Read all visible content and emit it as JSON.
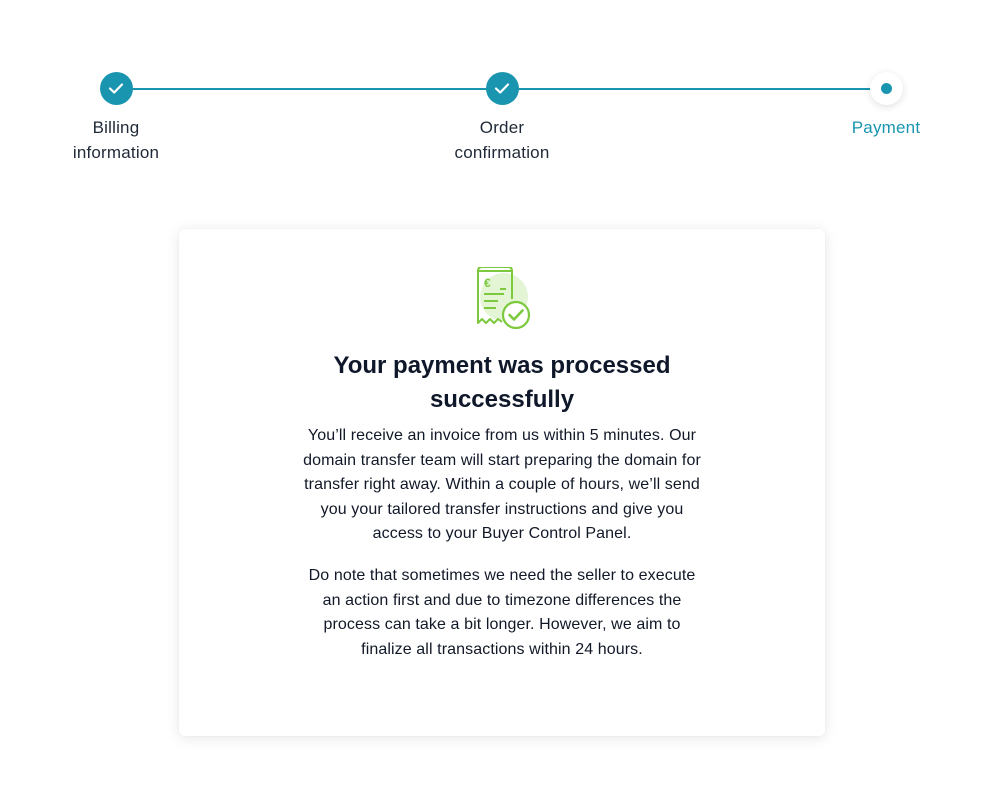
{
  "stepper": {
    "steps": [
      {
        "line1": "Billing",
        "line2": "information",
        "state": "done"
      },
      {
        "line1": "Order",
        "line2": "confirmation",
        "state": "done"
      },
      {
        "line1": "Payment",
        "line2": "",
        "state": "current"
      }
    ],
    "accent_color": "#1a95b0"
  },
  "card": {
    "icon": "receipt-euro-check-icon",
    "icon_currency": "€",
    "title_line1": "Your payment was processed",
    "title_line2": "successfully",
    "paragraph1_lines": [
      "You’ll receive an invoice from us within 5 minutes. Our",
      "domain transfer team will start preparing the domain for",
      "transfer right away. Within a couple of hours, we’ll send",
      "you your tailored transfer instructions and give you",
      "access to your Buyer Control Panel."
    ],
    "paragraph2_lines": [
      "Do note that sometimes we need the seller to execute",
      "an action first and due to timezone differences the",
      "process can take a bit longer. However, we aim to",
      "finalize all transactions within 24 hours."
    ],
    "icon_color": "#7cc93e"
  }
}
